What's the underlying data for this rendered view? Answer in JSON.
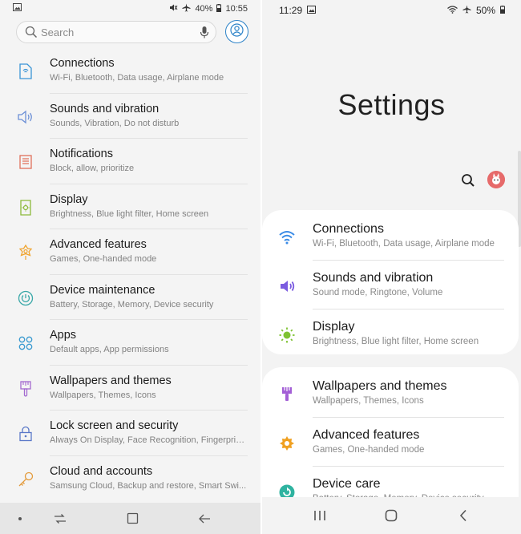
{
  "left_phone": {
    "status": {
      "time": "10:55",
      "battery": "40%"
    },
    "search_placeholder": "Search",
    "items": [
      {
        "title": "Connections",
        "subtitle": "Wi-Fi, Bluetooth, Data usage, Airplane mode",
        "icon": "connections-icon"
      },
      {
        "title": "Sounds and vibration",
        "subtitle": "Sounds, Vibration, Do not disturb",
        "icon": "speaker-icon"
      },
      {
        "title": "Notifications",
        "subtitle": "Block, allow, prioritize",
        "icon": "notifications-icon"
      },
      {
        "title": "Display",
        "subtitle": "Brightness, Blue light filter, Home screen",
        "icon": "display-icon"
      },
      {
        "title": "Advanced features",
        "subtitle": "Games, One-handed mode",
        "icon": "advanced-features-icon"
      },
      {
        "title": "Device maintenance",
        "subtitle": "Battery, Storage, Memory, Device security",
        "icon": "device-maintenance-icon"
      },
      {
        "title": "Apps",
        "subtitle": "Default apps, App permissions",
        "icon": "apps-icon"
      },
      {
        "title": "Wallpapers and themes",
        "subtitle": "Wallpapers, Themes, Icons",
        "icon": "paintbrush-icon"
      },
      {
        "title": "Lock screen and security",
        "subtitle": "Always On Display, Face Recognition, Fingerprin...",
        "icon": "lock-icon"
      },
      {
        "title": "Cloud and accounts",
        "subtitle": "Samsung Cloud, Backup and restore, Smart Swi...",
        "icon": "key-icon"
      }
    ]
  },
  "right_phone": {
    "status": {
      "time": "11:29",
      "battery": "50%"
    },
    "title": "Settings",
    "group1": [
      {
        "title": "Connections",
        "subtitle": "Wi-Fi, Bluetooth, Data usage, Airplane mode",
        "icon": "wifi-icon"
      },
      {
        "title": "Sounds and vibration",
        "subtitle": "Sound mode, Ringtone, Volume",
        "icon": "speaker-icon"
      },
      {
        "title": "Display",
        "subtitle": "Brightness, Blue light filter, Home screen",
        "icon": "sun-icon"
      }
    ],
    "group2": [
      {
        "title": "Wallpapers and themes",
        "subtitle": "Wallpapers, Themes, Icons",
        "icon": "paintbrush-icon"
      },
      {
        "title": "Advanced features",
        "subtitle": "Games, One-handed mode",
        "icon": "puzzle-gear-icon"
      },
      {
        "title": "Device care",
        "subtitle": "Battery, Storage, Memory, Device security",
        "icon": "device-care-icon"
      }
    ]
  },
  "colors": {
    "left_accent": "#2d83c8",
    "right_blue": "#3a8be6",
    "right_purple": "#7b5ce0",
    "right_green": "#7ec232",
    "right_lavender": "#a35fd6",
    "right_orange": "#f0a020",
    "right_teal": "#2fb3a0"
  }
}
